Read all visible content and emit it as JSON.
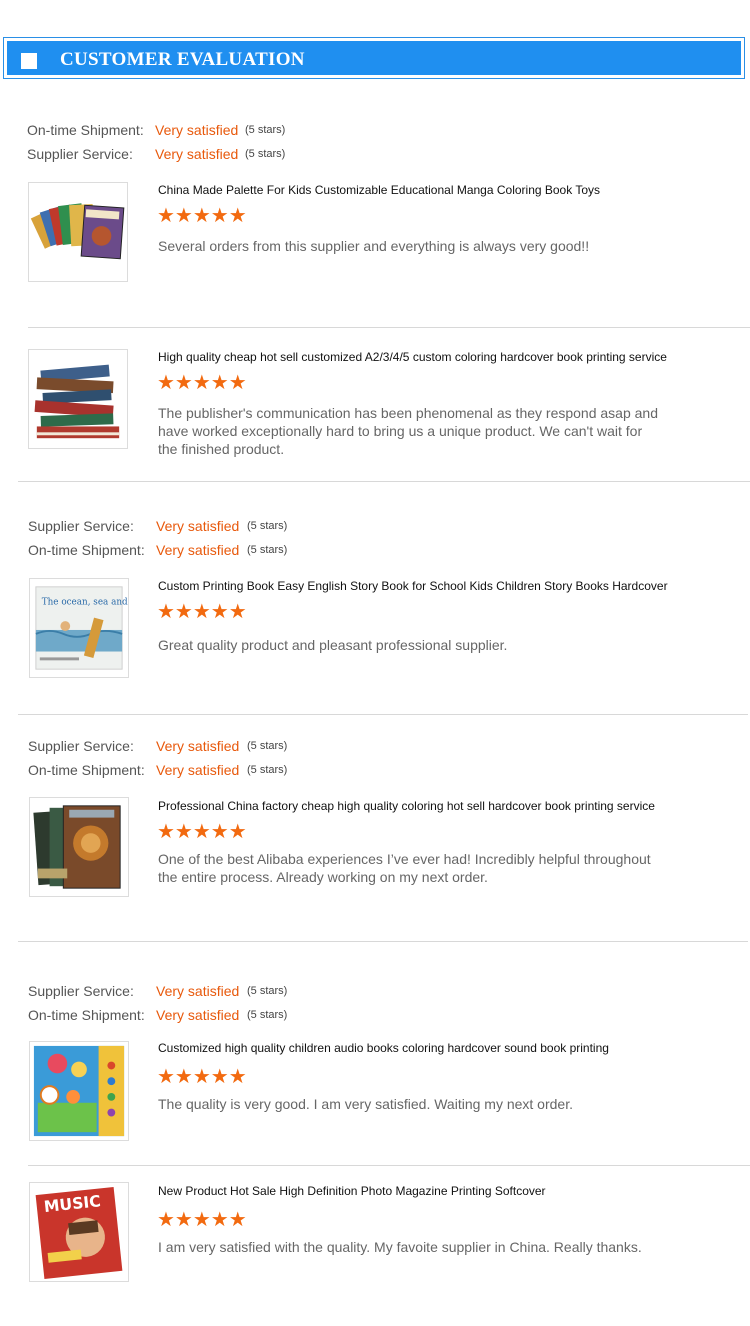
{
  "header": {
    "title": "CUSTOMER EVALUATION"
  },
  "ratings": {
    "shipment_label": "On-time Shipment:",
    "service_label": "Supplier Service:",
    "value": "Very satisfied",
    "stars_text": "(5 stars)"
  },
  "star_glyphs": "★★★★★",
  "reviews": [
    {
      "title": "China Made Palette For Kids Customizable Educational Manga Coloring Book Toys",
      "comment": "Several orders from this supplier and everything is always very good!!",
      "image": "comic-books-fan"
    },
    {
      "title": "High quality cheap hot sell customized A2/3/4/5 custom coloring hardcover book printing service",
      "comment": "The publisher's communication has been phenomenal as they respond asap and have worked exceptionally hard to bring us a unique product. We can't wait for the finished product.",
      "image": "hardcover-book-stack"
    },
    {
      "title": "Custom Printing Book Easy English Story Book for School Kids Children Story Books Hardcover",
      "comment": "Great quality product and pleasant professional supplier.",
      "image": "ocean-story-book",
      "cover_text": "The ocean, sea and me"
    },
    {
      "title": "Professional China factory cheap high quality coloring hot sell hardcover book printing service",
      "comment": "One of the best Alibaba experiences I’ve ever had! Incredibly helpful throughout the entire process. Already working on my next order.",
      "image": "lion-hardcover-books"
    },
    {
      "title": "Customized high quality children audio books coloring hardcover sound book printing",
      "comment": "The quality is very good. I am very satisfied. Waiting my next order.",
      "image": "children-sound-book"
    },
    {
      "title": "New Product Hot Sale High Definition Photo Magazine Printing Softcover",
      "comment": "I am very satisfied with the quality. My favoite supplier in China. Really thanks.",
      "image": "music-magazine",
      "cover_text": "MUSIC"
    }
  ]
}
